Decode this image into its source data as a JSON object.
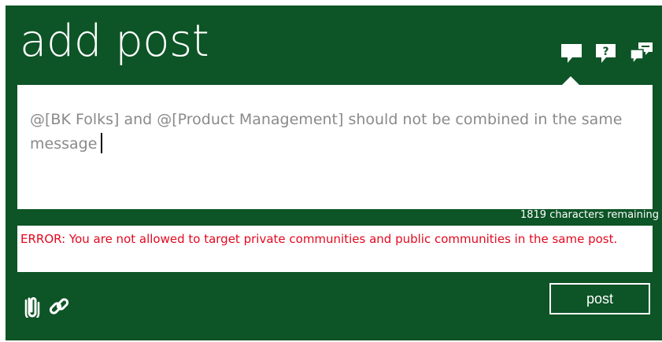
{
  "header": {
    "title": "add post",
    "post_type_icons": [
      "speech-bubble-icon",
      "question-bubble-icon",
      "announcement-bubble-icon"
    ]
  },
  "composer": {
    "text": "@[BK Folks] and @[Product Management] should not be combined in the same message",
    "characters_remaining": "1819 characters remaining"
  },
  "error": {
    "message": "ERROR: You are not allowed to target private communities and public communities in the same post."
  },
  "toolbar": {
    "icons": [
      "attachment-icon",
      "link-icon"
    ],
    "post_label": "post"
  },
  "colors": {
    "panel_bg": "#0d5426",
    "error_text": "#e4081f",
    "composer_text": "#8a8a8a",
    "white": "#ffffff"
  }
}
